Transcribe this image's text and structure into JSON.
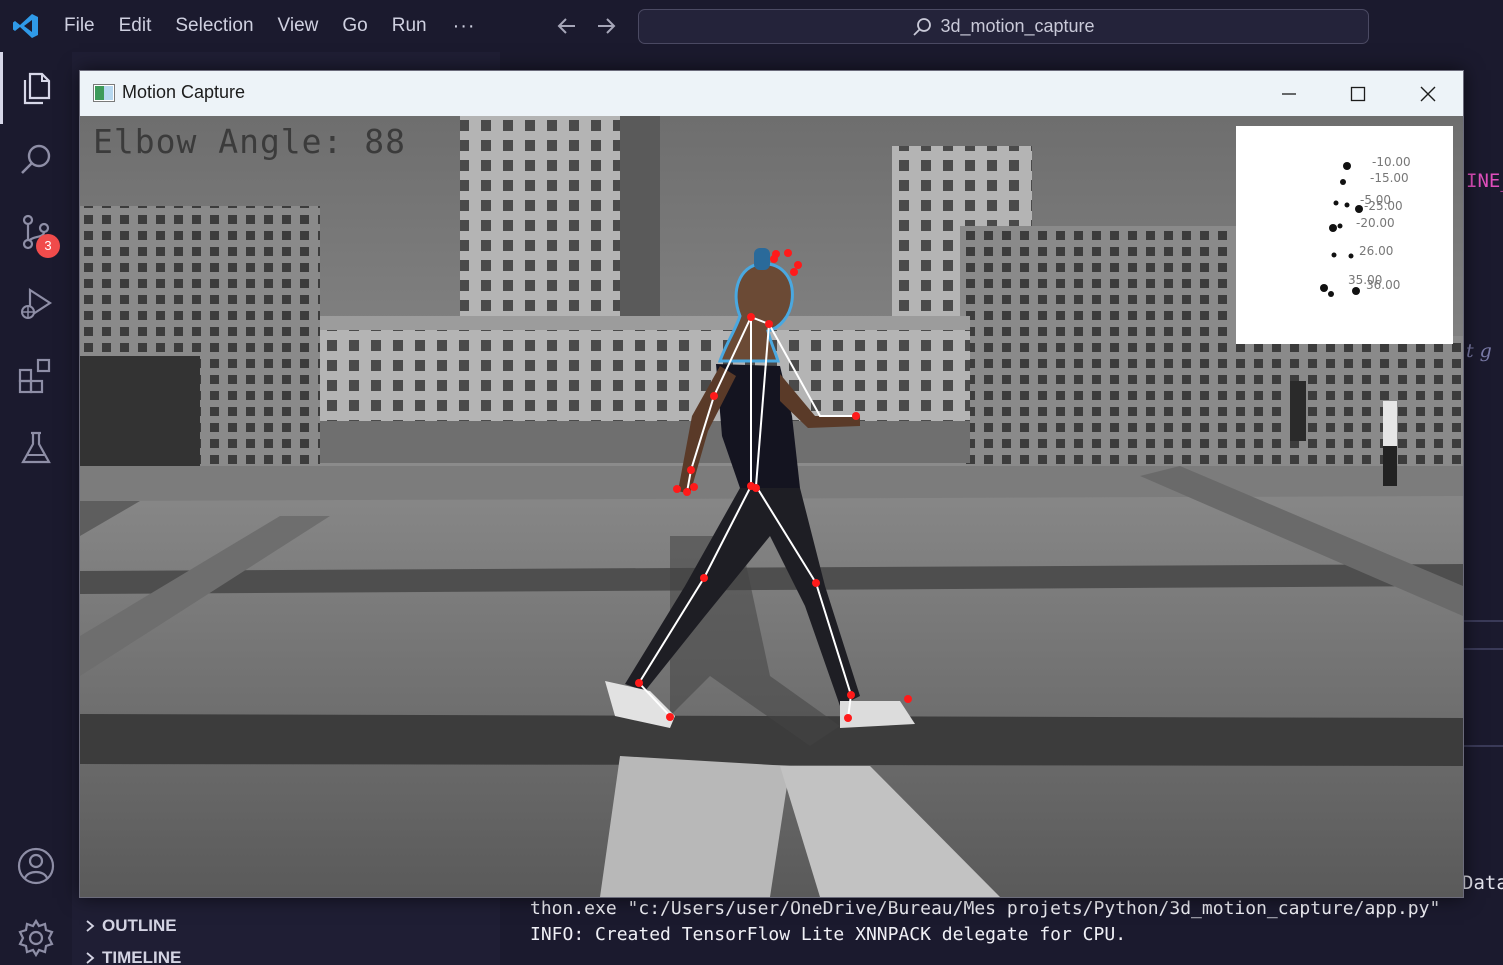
{
  "menubar": {
    "items": [
      "File",
      "Edit",
      "Selection",
      "View",
      "Go",
      "Run"
    ],
    "more": "···"
  },
  "command_center": {
    "text": "3d_motion_capture"
  },
  "activity_bar": {
    "icons": [
      "explorer-icon",
      "search-icon",
      "source-control-icon",
      "run-debug-icon",
      "extensions-icon",
      "testing-icon",
      "account-icon",
      "settings-gear-icon"
    ],
    "scm_badge": "3"
  },
  "sidebar": {
    "sections": [
      {
        "label": "OUTLINE"
      },
      {
        "label": "TIMELINE"
      }
    ]
  },
  "editor_peek": {
    "line1": "INE_",
    "line2": "t g",
    "line3": "Data/"
  },
  "terminal": {
    "lines": [
      "thon.exe \"c:/Users/user/OneDrive/Bureau/Mes projets/Python/3d_motion_capture/app.py\"",
      "INFO: Created TensorFlow Lite XNNPACK delegate for CPU."
    ]
  },
  "motion_window": {
    "title": "Motion Capture",
    "overlay_text": "Elbow Angle: 88",
    "plot_labels": [
      "-10.00",
      "-15.00",
      "-5.00",
      "-20.00",
      "-25.00",
      "26.00",
      "35.00",
      "36.00"
    ],
    "colors": {
      "keypoint": "#ff1a1a",
      "skeleton": "#ffffff",
      "silhouette_outline": "#4aa8e0"
    }
  }
}
